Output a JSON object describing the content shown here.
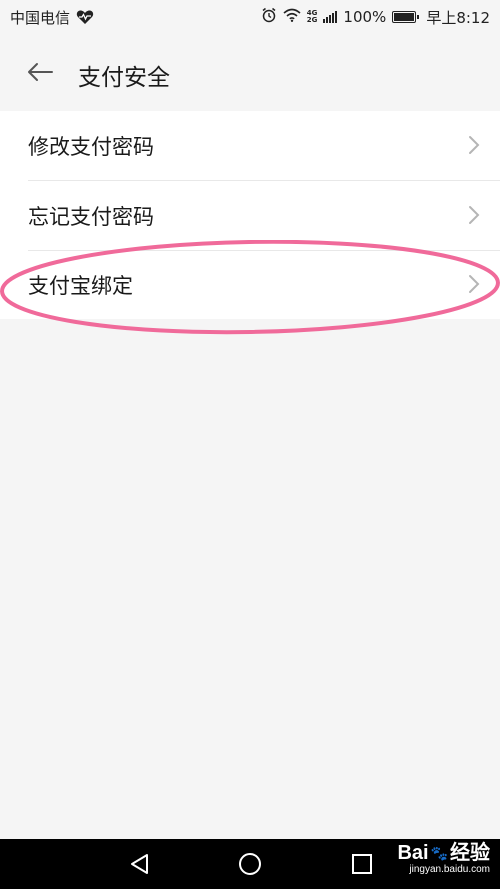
{
  "status_bar": {
    "carrier": "中国电信",
    "battery_percent": "100%",
    "time": "早上8:12",
    "network_label_top": "4G",
    "network_label_bottom": "2G",
    "icons": [
      "heart-icon",
      "alarm-icon",
      "wifi-icon",
      "signal-icon",
      "battery-icon"
    ]
  },
  "header": {
    "title": "支付安全",
    "back_icon": "back-arrow-icon"
  },
  "menu": {
    "items": [
      {
        "label": "修改支付密码",
        "icon": "chevron-right-icon"
      },
      {
        "label": "忘记支付密码",
        "icon": "chevron-right-icon"
      },
      {
        "label": "支付宝绑定",
        "icon": "chevron-right-icon"
      }
    ]
  },
  "annotation": {
    "color": "#f06a9a"
  },
  "nav_bar": {
    "icons": [
      "nav-back-icon",
      "nav-home-icon",
      "nav-recent-icon"
    ]
  },
  "watermark": {
    "brand_prefix": "Bai",
    "brand_suffix": "经验",
    "url": "jingyan.baidu.com"
  },
  "colors": {
    "background": "#f5f5f5",
    "card": "#ffffff",
    "text": "#1a1a1a",
    "chevron": "#b5b5b5",
    "divider": "#e8e8e8"
  }
}
